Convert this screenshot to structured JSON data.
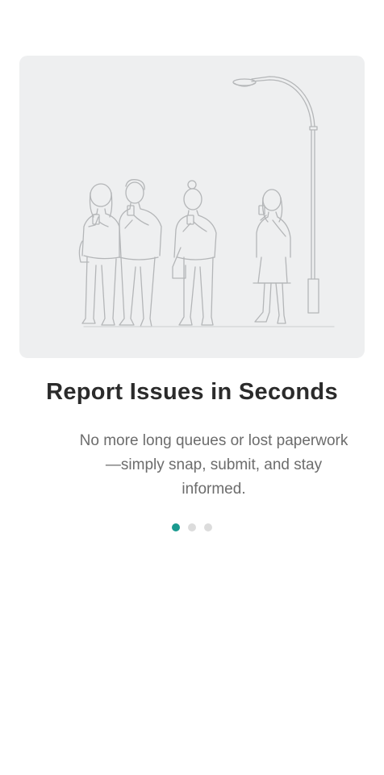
{
  "onboarding": {
    "title": "Report Issues in Seconds",
    "description": "No more long queues or lost paperwork—simply snap, submit, and stay informed.",
    "illustration_icon": "people-waiting-under-streetlamp-illustration",
    "pagination": {
      "current": 1,
      "total": 3
    }
  },
  "colors": {
    "accent": "#1a9a8f",
    "inactive_dot": "#dcdcdc",
    "illustration_bg": "#eeeff0",
    "title": "#2b2b2b",
    "body": "#6c6c6c"
  }
}
